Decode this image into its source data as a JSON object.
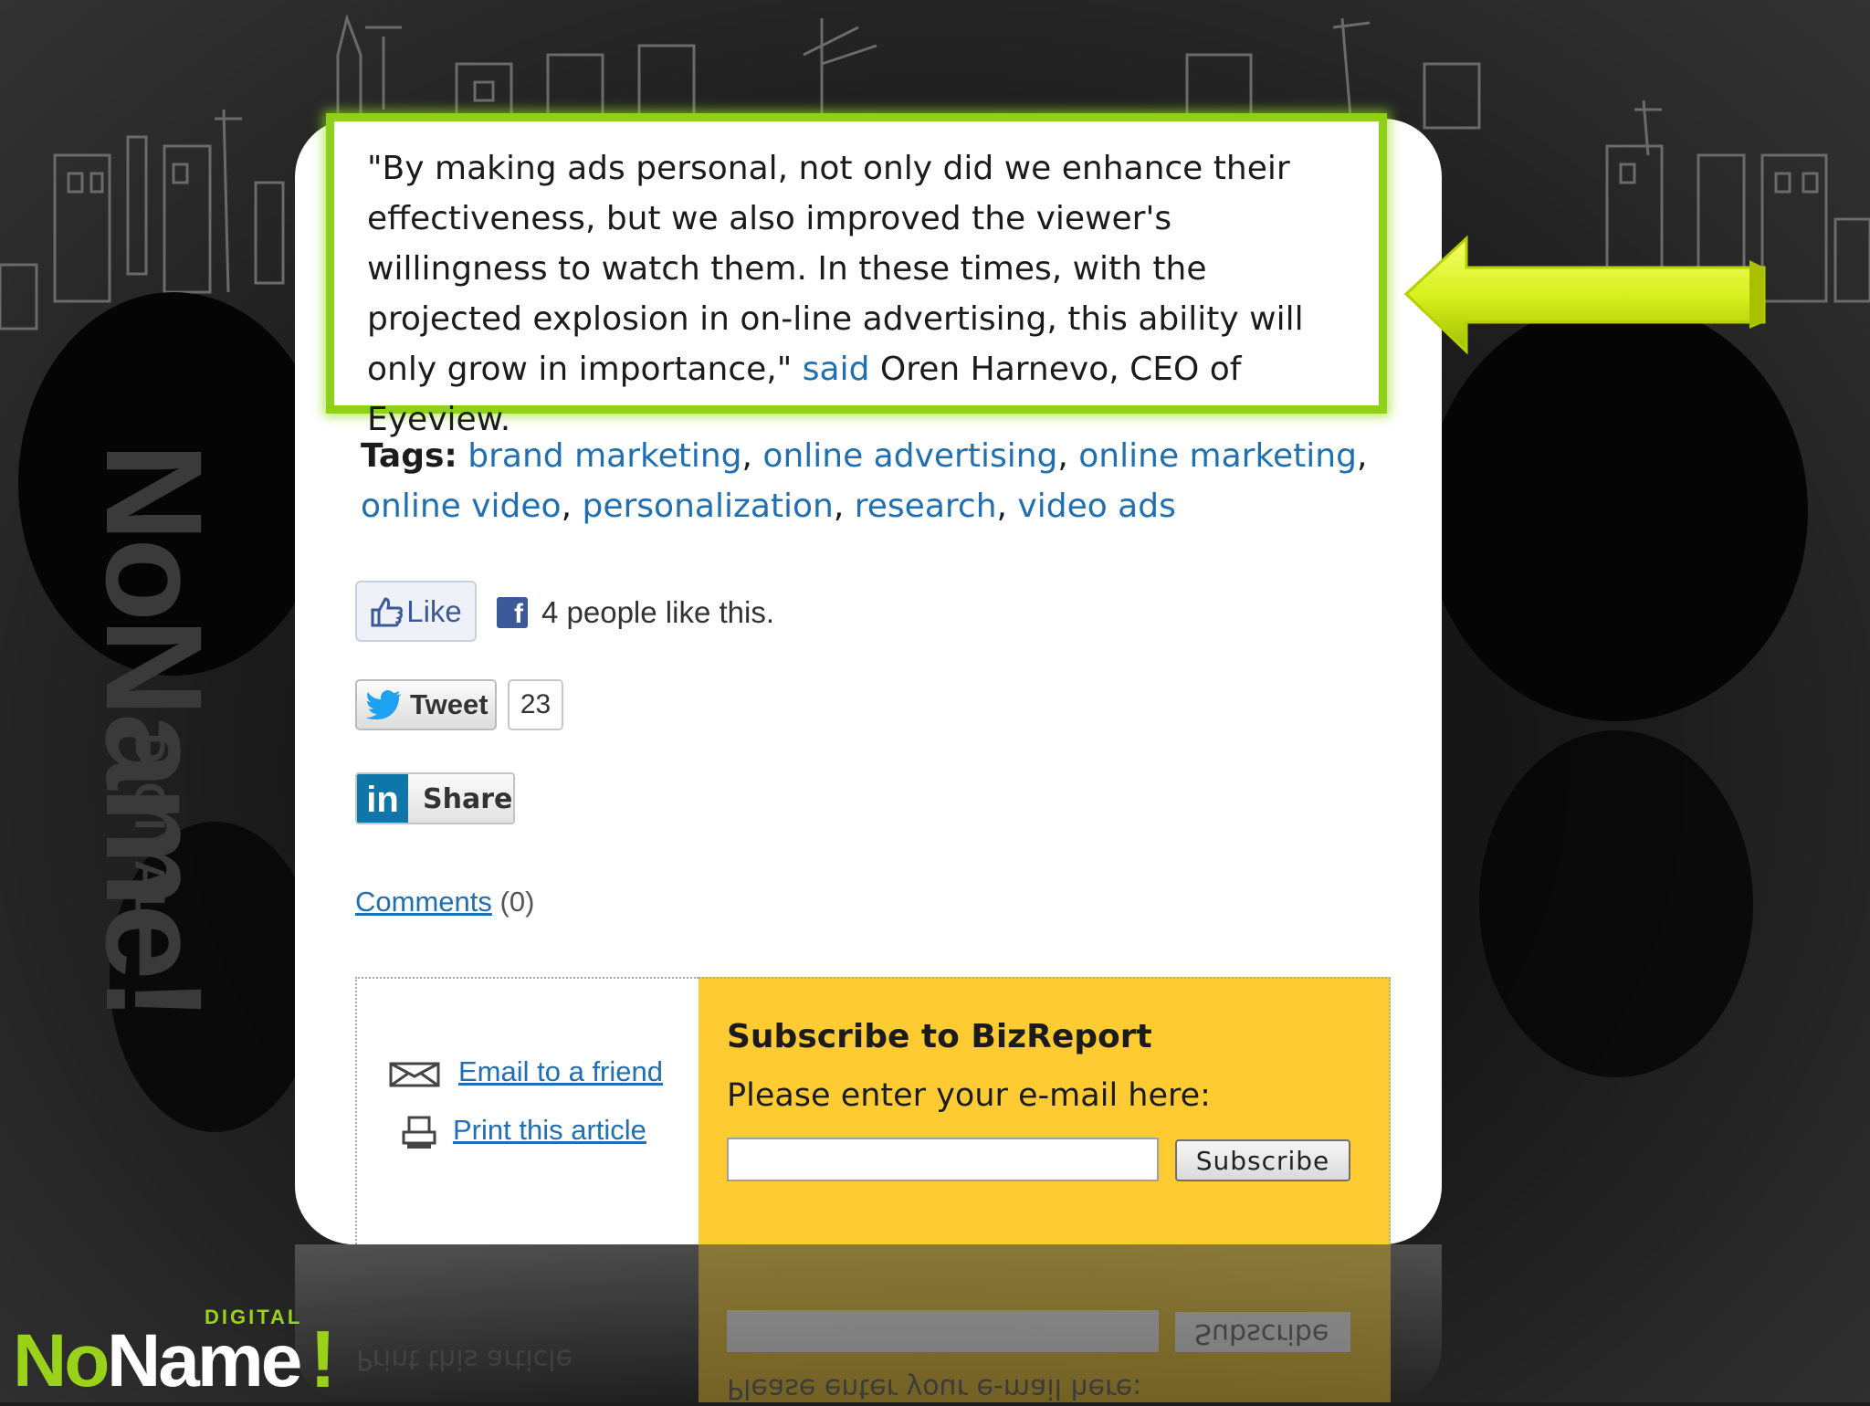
{
  "quote": {
    "text_before": "\"By making ads personal, not only did we enhance their effectiveness, but we also improved the viewer's willingness to watch them. In these times, with the projected explosion in on-line advertising, this ability will only grow in importance,\" ",
    "said_link": "said",
    "text_after": " Oren Harnevo, CEO of Eyeview."
  },
  "tags": {
    "label": "Tags:",
    "items": [
      "brand marketing",
      "online advertising",
      "online marketing",
      "online video",
      "personalization",
      "research",
      "video ads"
    ],
    "separator": ", "
  },
  "social": {
    "like_label": "Like",
    "like_count_text": "4 people like this.",
    "fb_glyph": "f",
    "tweet_label": "Tweet",
    "tweet_count": "23",
    "linkedin_glyph": "in",
    "linkedin_label": "Share"
  },
  "comments": {
    "link": "Comments",
    "count": "(0)"
  },
  "actions": {
    "email_label": "Email to a friend",
    "print_label": "Print this article"
  },
  "subscribe": {
    "title": "Subscribe to BizReport",
    "prompt": "Please enter your e-mail here:",
    "input_value": "",
    "button_label": "Subscribe"
  },
  "reflection": {
    "print_label": "Print this article",
    "prompt": "Please enter your e-mail here:",
    "button_label": "Subscribe"
  },
  "brand": {
    "no": "No",
    "name": "Name",
    "bang": "!",
    "digital": "DIGITAL",
    "vertical": "NoName!",
    "vertical_digital": "DIGITAL"
  },
  "colors": {
    "highlight_green": "#8fd11a",
    "arrow_yellow_green": "#d8f01e",
    "link_blue": "#1f6fb2",
    "subscribe_yellow": "#ffcb33",
    "facebook_blue": "#3b5998",
    "linkedin_blue": "#0e76a8",
    "twitter_blue": "#1da1f2"
  }
}
